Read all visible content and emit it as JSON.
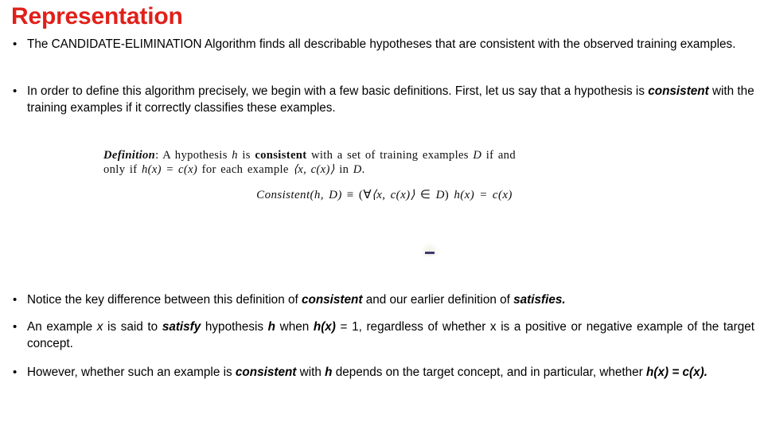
{
  "slide": {
    "title": "Representation",
    "title_color": "#e0201a",
    "background_color": "#ffffff"
  },
  "bullets": [
    {
      "marker": "•",
      "id": "bullet-candidate-elimination",
      "text": "The CANDIDATE-ELIMINATION Algorithm finds all describable hypotheses that are consistent with the observed training examples."
    },
    {
      "marker": "•",
      "id": "bullet-define-algorithm",
      "prefix": "In order to define this algorithm precisely, we begin with a few basic definitions. First, let us say that a hypothesis is ",
      "emphasis": "consistent",
      "suffix": " with the training examples if it correctly classifies these examples."
    },
    {
      "marker": "•",
      "id": "bullet-key-difference",
      "part1": "Notice the key difference between this definition of ",
      "em1": "consistent",
      "part2": " and our earlier definition of ",
      "em2": "satisfies."
    },
    {
      "marker": "•",
      "id": "bullet-satisfy-definition",
      "p1": "An example ",
      "v1": "x",
      "p2": " is said to ",
      "e1": "satisfy",
      "p3": " hypothesis ",
      "v2": "h",
      "p4": " when ",
      "e2": "h(x)",
      "p5": " = 1, regardless of whether x is a positive or negative example of the target concept."
    },
    {
      "marker": "•",
      "id": "bullet-consistent-depends",
      "p1": "However, whether such an example is ",
      "e1": "consistent",
      "p2": " with ",
      "v1": "h",
      "p3": " depends on the target concept, and in particular, whether ",
      "e2": "h(x) = c(x)."
    }
  ],
  "definition_figure": {
    "label": "Definition",
    "line1_colon": ":",
    "line1_a": " A hypothesis ",
    "line1_h": "h",
    "line1_b": " is ",
    "line1_consistent": "consistent",
    "line1_c": " with a set of training examples ",
    "line1_D": "D",
    "line1_d": " if and",
    "line2_a": "only if ",
    "line2_expr": "h(x) = c(x)",
    "line2_b": " for each example ",
    "line2_pair": "⟨x, c(x)⟩",
    "line2_c": " in ",
    "line2_D": "D",
    "line2_d": ".",
    "formula_name": "Consistent",
    "formula_args": "(h, D)",
    "formula_equiv": " ≡ ",
    "formula_quant": "(",
    "formula_forall": "∀",
    "formula_pair": "⟨x, c(x)⟩",
    "formula_in": " ∈ ",
    "formula_D": "D",
    "formula_close": ") ",
    "formula_tail": "h(x) = c(x)"
  }
}
